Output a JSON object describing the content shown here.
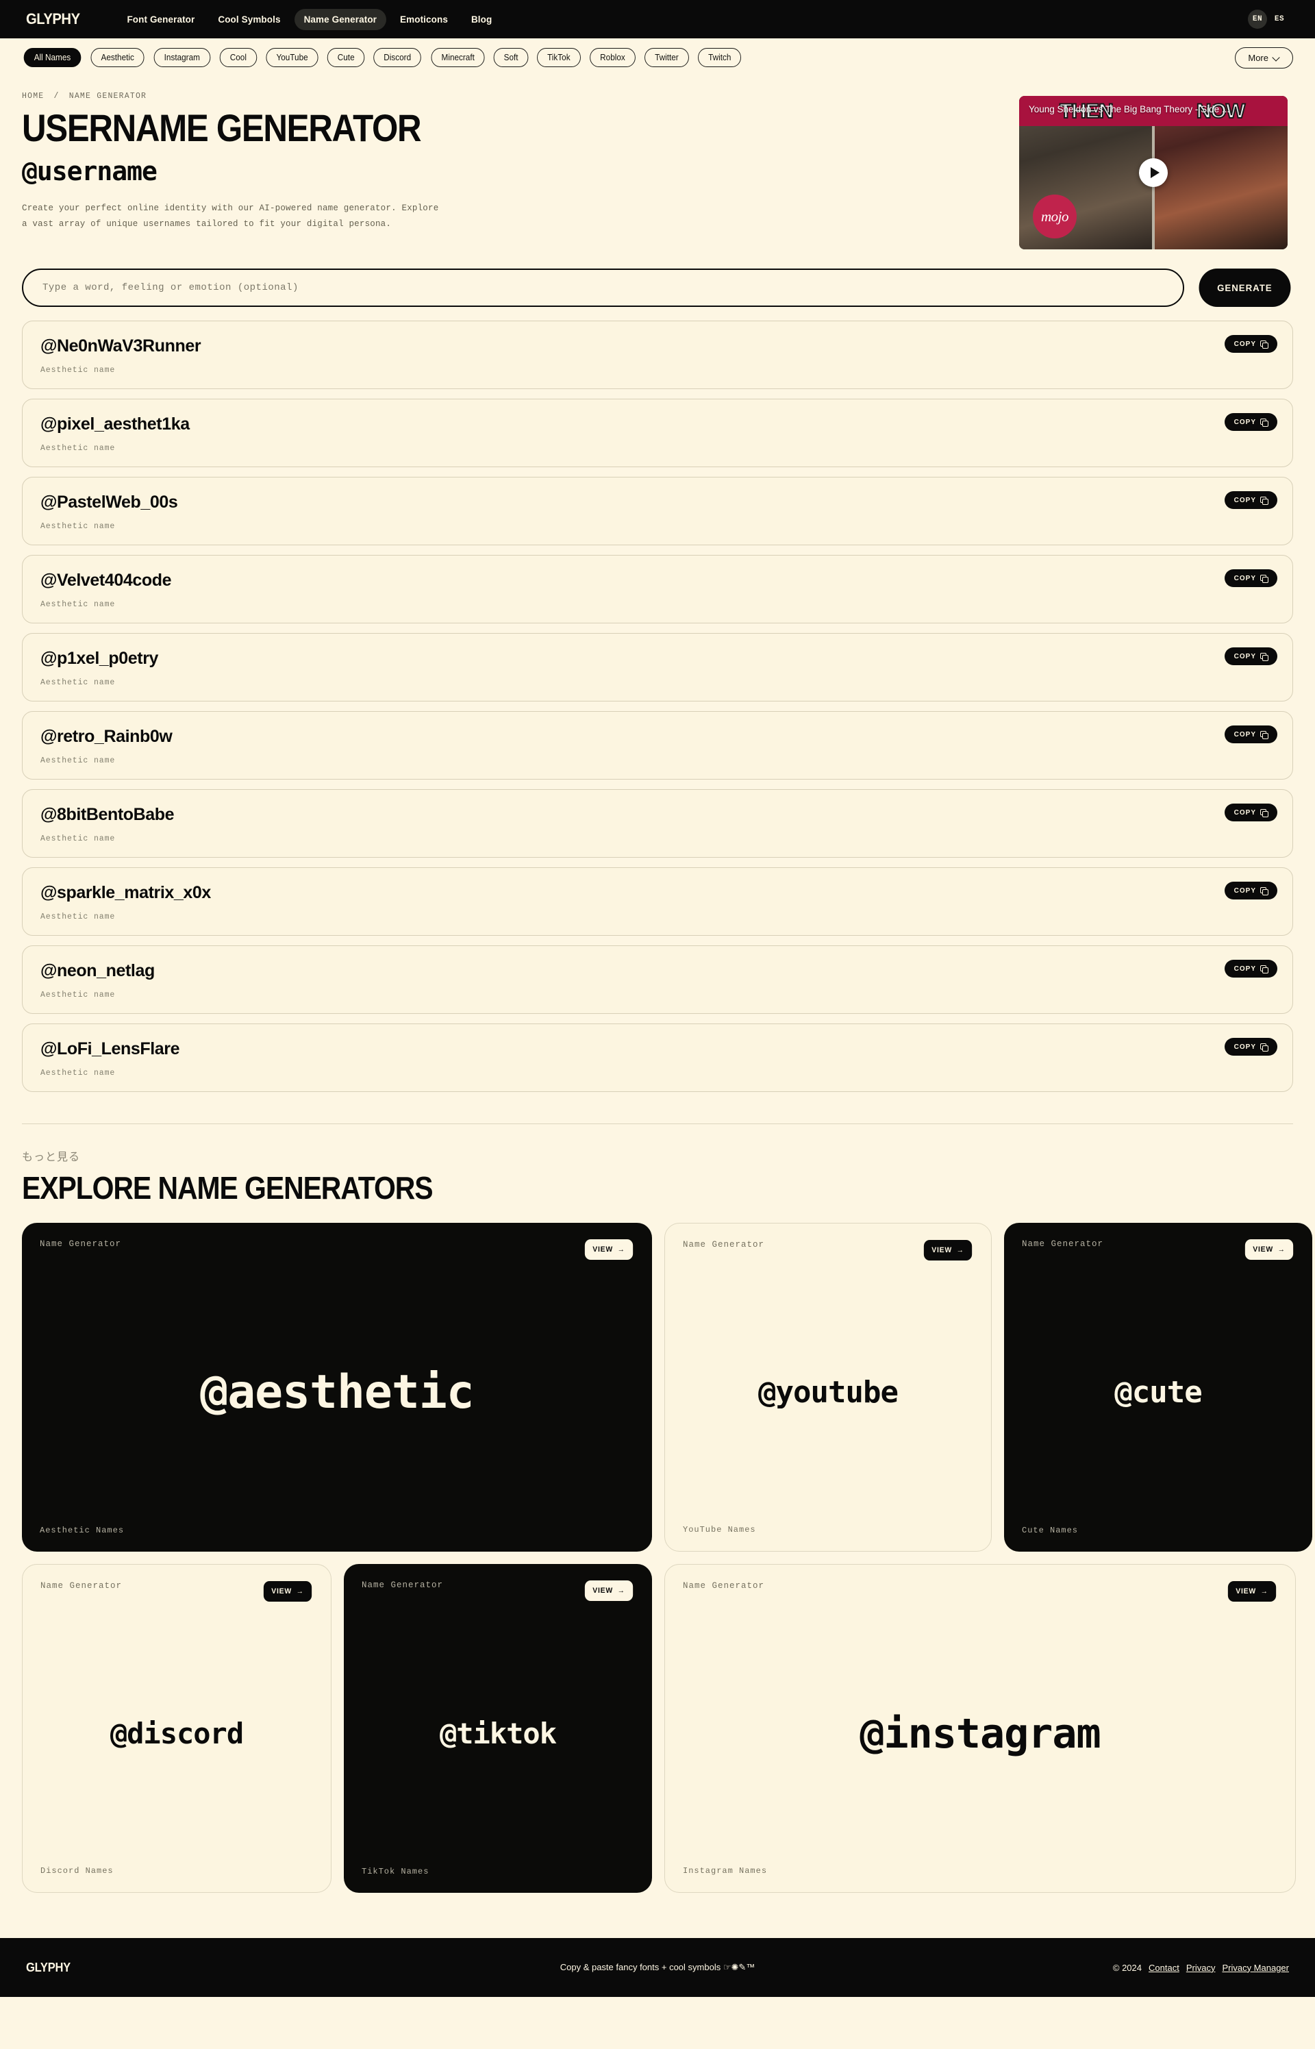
{
  "brand": "GLYPHY",
  "nav": {
    "links": [
      {
        "label": "Font Generator",
        "active": false
      },
      {
        "label": "Cool Symbols",
        "active": false
      },
      {
        "label": "Name Generator",
        "active": true
      },
      {
        "label": "Emoticons",
        "active": false
      },
      {
        "label": "Blog",
        "active": false
      }
    ],
    "languages": [
      {
        "label": "EN",
        "active": true
      },
      {
        "label": "ES",
        "active": false
      }
    ]
  },
  "categories": [
    {
      "label": "All Names",
      "active": true
    },
    {
      "label": "Aesthetic",
      "active": false
    },
    {
      "label": "Instagram",
      "active": false
    },
    {
      "label": "Cool",
      "active": false
    },
    {
      "label": "YouTube",
      "active": false
    },
    {
      "label": "Cute",
      "active": false
    },
    {
      "label": "Discord",
      "active": false
    },
    {
      "label": "Minecraft",
      "active": false
    },
    {
      "label": "Soft",
      "active": false
    },
    {
      "label": "TikTok",
      "active": false
    },
    {
      "label": "Roblox",
      "active": false
    },
    {
      "label": "Twitter",
      "active": false
    },
    {
      "label": "Twitch",
      "active": false
    }
  ],
  "more_button": "More",
  "breadcrumb": {
    "home": "HOME",
    "separator": "/",
    "current": "NAME GENERATOR"
  },
  "hero": {
    "title": "USERNAME GENERATOR",
    "handle": "@username",
    "description": "Create your perfect online identity with our AI-powered name generator. Explore a vast array of unique usernames tailored to fit your digital persona."
  },
  "video": {
    "title": "Young Sheldon vs The Big Bang Theory - Side ...",
    "then_label": "THEN",
    "now_label": "NOW",
    "watermark": "mojo",
    "play_icon": "play-icon"
  },
  "search": {
    "placeholder": "Type a word, feeling or emotion (optional)",
    "value": "",
    "generate_label": "GENERATE"
  },
  "copy_label": "COPY",
  "results": [
    {
      "name": "@Ne0nWaV3Runner",
      "sub": "Aesthetic name"
    },
    {
      "name": "@pixel_aesthet1ka",
      "sub": "Aesthetic name"
    },
    {
      "name": "@PastelWeb_00s",
      "sub": "Aesthetic name"
    },
    {
      "name": "@Velvet404code",
      "sub": "Aesthetic name"
    },
    {
      "name": "@p1xel_p0etry",
      "sub": "Aesthetic name"
    },
    {
      "name": "@retro_Rainb0w",
      "sub": "Aesthetic name"
    },
    {
      "name": "@8bitBentoBabe",
      "sub": "Aesthetic name"
    },
    {
      "name": "@sparkle_matrix_x0x",
      "sub": "Aesthetic name"
    },
    {
      "name": "@neon_netlag",
      "sub": "Aesthetic name"
    },
    {
      "name": "@LoFi_LensFlare",
      "sub": "Aesthetic name"
    }
  ],
  "explore": {
    "kicker": "もっと見る",
    "title": "EXPLORE NAME GENERATORS",
    "view_label": "VIEW",
    "cards_row1": [
      {
        "kicker": "Name Generator",
        "handle": "@aesthetic",
        "footer": "Aesthetic Names",
        "theme": "dark",
        "handle_size": "68px"
      },
      {
        "kicker": "Name Generator",
        "handle": "@youtube",
        "footer": "YouTube Names",
        "theme": "light",
        "handle_size": "44px"
      },
      {
        "kicker": "Name Generator",
        "handle": "@cute",
        "footer": "Cute Names",
        "theme": "dark",
        "handle_size": "44px"
      }
    ],
    "cards_row2": [
      {
        "kicker": "Name Generator",
        "handle": "@discord",
        "footer": "Discord Names",
        "theme": "light",
        "handle_size": "42px"
      },
      {
        "kicker": "Name Generator",
        "handle": "@tiktok",
        "footer": "TikTok Names",
        "theme": "dark",
        "handle_size": "42px"
      },
      {
        "kicker": "Name Generator",
        "handle": "@instagram",
        "footer": "Instagram Names",
        "theme": "light",
        "handle_size": "60px"
      }
    ]
  },
  "footer": {
    "brand": "GLYPHY",
    "tagline": "Copy & paste fancy fonts + cool symbols ☞✺✎™",
    "copyright": "© 2024",
    "links": [
      "Contact",
      "Privacy",
      "Privacy Manager"
    ]
  },
  "colors": {
    "bg": "#FDF6E3",
    "ink": "#0A0A0A",
    "muted": "#83806F",
    "card_border": "#D8D0B8",
    "video_accent": "#A8123E"
  }
}
